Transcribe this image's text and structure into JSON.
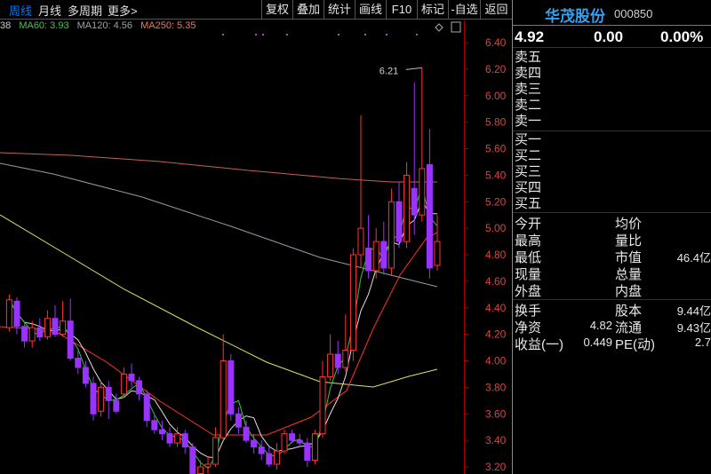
{
  "toolbar": {
    "periods": [
      "周线",
      "月线",
      "多周期",
      "更多>"
    ],
    "buttons": [
      "复权",
      "叠加",
      "统计",
      "画线",
      "F10",
      "标记",
      "-自选",
      "返回"
    ]
  },
  "ma_legend": [
    {
      "text": "38",
      "color": "#cccccc"
    },
    {
      "text": "MA60: 3.93",
      "color": "#4ac24a"
    },
    {
      "text": "MA120: 4.56",
      "color": "#a0a0a0"
    },
    {
      "text": "MA250: 5.35",
      "color": "#ff7050"
    }
  ],
  "colors": {
    "up": "#ff3333",
    "down": "#9933ff",
    "ma5": "#e0e0e0",
    "ma10": "#e0e060",
    "ma20": "#ff3030",
    "ma60": "#2ecc2e",
    "ma120": "#9a9aa8",
    "ma250": "#c06450",
    "axis_text": "#e04040",
    "stock_name": "#34a0f0"
  },
  "chart_data": {
    "type": "candlestick",
    "y_ticks": [
      "6.40",
      "6.20",
      "6.00",
      "5.80",
      "5.60",
      "5.40",
      "5.20",
      "5.00",
      "4.80",
      "4.60",
      "4.40",
      "4.20",
      "4.00",
      "3.80",
      "3.60",
      "3.40",
      "3.20"
    ],
    "annotation": "6.21",
    "candles": [
      {
        "o": 4.25,
        "c": 4.46,
        "h": 4.5,
        "l": 4.22
      },
      {
        "o": 4.45,
        "c": 4.26,
        "h": 4.48,
        "l": 4.2
      },
      {
        "o": 4.26,
        "c": 4.15,
        "h": 4.3,
        "l": 4.1
      },
      {
        "o": 4.15,
        "c": 4.25,
        "h": 4.3,
        "l": 4.1
      },
      {
        "o": 4.25,
        "c": 4.18,
        "h": 4.32,
        "l": 4.15
      },
      {
        "o": 4.18,
        "c": 4.32,
        "h": 4.38,
        "l": 4.16
      },
      {
        "o": 4.32,
        "c": 4.2,
        "h": 4.42,
        "l": 4.18
      },
      {
        "o": 4.2,
        "c": 4.3,
        "h": 4.45,
        "l": 4.18
      },
      {
        "o": 4.3,
        "c": 4.02,
        "h": 4.47,
        "l": 4.0
      },
      {
        "o": 4.02,
        "c": 3.95,
        "h": 4.08,
        "l": 3.9
      },
      {
        "o": 3.95,
        "c": 3.83,
        "h": 4.0,
        "l": 3.8
      },
      {
        "o": 3.83,
        "c": 3.6,
        "h": 3.88,
        "l": 3.55
      },
      {
        "o": 3.62,
        "c": 3.8,
        "h": 3.85,
        "l": 3.58
      },
      {
        "o": 3.8,
        "c": 3.7,
        "h": 3.85,
        "l": 3.56
      },
      {
        "o": 3.7,
        "c": 3.62,
        "h": 3.75,
        "l": 3.6
      },
      {
        "o": 3.75,
        "c": 3.9,
        "h": 3.95,
        "l": 3.72
      },
      {
        "o": 3.9,
        "c": 3.85,
        "h": 3.98,
        "l": 3.8
      },
      {
        "o": 3.85,
        "c": 3.75,
        "h": 3.88,
        "l": 3.7
      },
      {
        "o": 3.75,
        "c": 3.55,
        "h": 3.78,
        "l": 3.5
      },
      {
        "o": 3.55,
        "c": 3.48,
        "h": 3.6,
        "l": 3.45
      },
      {
        "o": 3.48,
        "c": 3.45,
        "h": 3.55,
        "l": 3.4
      },
      {
        "o": 3.45,
        "c": 3.38,
        "h": 3.5,
        "l": 3.35
      },
      {
        "o": 3.38,
        "c": 3.45,
        "h": 3.5,
        "l": 3.35
      },
      {
        "o": 3.45,
        "c": 3.35,
        "h": 3.48,
        "l": 3.3
      },
      {
        "o": 3.35,
        "c": 3.15,
        "h": 3.38,
        "l": 3.1
      },
      {
        "o": 3.15,
        "c": 3.2,
        "h": 3.25,
        "l": 3.1
      },
      {
        "o": 3.2,
        "c": 3.22,
        "h": 3.28,
        "l": 3.15
      },
      {
        "o": 3.22,
        "c": 3.42,
        "h": 3.5,
        "l": 3.2
      },
      {
        "o": 3.42,
        "c": 4.0,
        "h": 4.2,
        "l": 3.4
      },
      {
        "o": 4.0,
        "c": 3.6,
        "h": 4.05,
        "l": 3.55
      },
      {
        "o": 3.6,
        "c": 3.5,
        "h": 3.65,
        "l": 3.45
      },
      {
        "o": 3.5,
        "c": 3.4,
        "h": 3.55,
        "l": 3.38
      },
      {
        "o": 3.4,
        "c": 3.35,
        "h": 3.45,
        "l": 3.3
      },
      {
        "o": 3.35,
        "c": 3.3,
        "h": 3.4,
        "l": 3.25
      },
      {
        "o": 3.3,
        "c": 3.22,
        "h": 3.35,
        "l": 3.2
      },
      {
        "o": 3.22,
        "c": 3.32,
        "h": 3.38,
        "l": 3.18
      },
      {
        "o": 3.32,
        "c": 3.45,
        "h": 3.48,
        "l": 3.3
      },
      {
        "o": 3.45,
        "c": 3.4,
        "h": 3.48,
        "l": 3.38
      },
      {
        "o": 3.4,
        "c": 3.38,
        "h": 3.45,
        "l": 3.36
      },
      {
        "o": 3.38,
        "c": 3.25,
        "h": 3.42,
        "l": 3.2
      },
      {
        "o": 3.25,
        "c": 3.45,
        "h": 3.48,
        "l": 3.22
      },
      {
        "o": 3.45,
        "c": 3.88,
        "h": 4.0,
        "l": 3.42
      },
      {
        "o": 3.88,
        "c": 4.05,
        "h": 4.2,
        "l": 3.85
      },
      {
        "o": 4.05,
        "c": 3.95,
        "h": 4.15,
        "l": 3.9
      },
      {
        "o": 3.95,
        "c": 4.08,
        "h": 4.35,
        "l": 3.92
      },
      {
        "o": 4.08,
        "c": 4.8,
        "h": 4.85,
        "l": 4.0
      },
      {
        "o": 4.8,
        "c": 5.0,
        "h": 5.85,
        "l": 4.7
      },
      {
        "o": 4.85,
        "c": 4.68,
        "h": 5.1,
        "l": 4.62
      },
      {
        "o": 4.68,
        "c": 4.9,
        "h": 5.0,
        "l": 4.62
      },
      {
        "o": 4.9,
        "c": 4.7,
        "h": 5.05,
        "l": 4.65
      },
      {
        "o": 4.7,
        "c": 5.2,
        "h": 5.3,
        "l": 4.65
      },
      {
        "o": 5.2,
        "c": 4.9,
        "h": 5.35,
        "l": 4.85
      },
      {
        "o": 4.9,
        "c": 5.4,
        "h": 5.5,
        "l": 4.85
      },
      {
        "o": 5.3,
        "c": 5.1,
        "h": 6.1,
        "l": 4.95
      },
      {
        "o": 5.1,
        "c": 5.45,
        "h": 6.21,
        "l": 5.05
      },
      {
        "o": 5.48,
        "c": 4.7,
        "h": 5.75,
        "l": 4.62
      },
      {
        "o": 4.72,
        "c": 4.9,
        "h": 5.1,
        "l": 4.68
      }
    ]
  },
  "panel": {
    "stock_name": "华茂股份",
    "stock_code": "000850",
    "price": "4.92",
    "change": "0.00",
    "change_pct": "0.00%",
    "sell": [
      "卖五",
      "卖四",
      "卖三",
      "卖二",
      "卖一"
    ],
    "buy": [
      "买一",
      "买二",
      "买三",
      "买四",
      "买五"
    ],
    "stats_a": [
      {
        "l": "今开",
        "v": "",
        "l2": "均价",
        "v2": ""
      },
      {
        "l": "最高",
        "v": "",
        "l2": "量比",
        "v2": ""
      },
      {
        "l": "最低",
        "v": "",
        "l2": "市值",
        "v2": "46.4亿"
      },
      {
        "l": "现量",
        "v": "",
        "l2": "总量",
        "v2": ""
      },
      {
        "l": "外盘",
        "v": "",
        "l2": "内盘",
        "v2": ""
      }
    ],
    "stats_b": [
      {
        "l": "换手",
        "v": "",
        "l2": "股本",
        "v2": "9.44亿"
      },
      {
        "l": "净资",
        "v": "4.82",
        "l2": "流通",
        "v2": "9.43亿"
      },
      {
        "l": "收益(一)",
        "v": "0.449",
        "l2": "PE(动)",
        "v2": "2.7"
      }
    ]
  }
}
